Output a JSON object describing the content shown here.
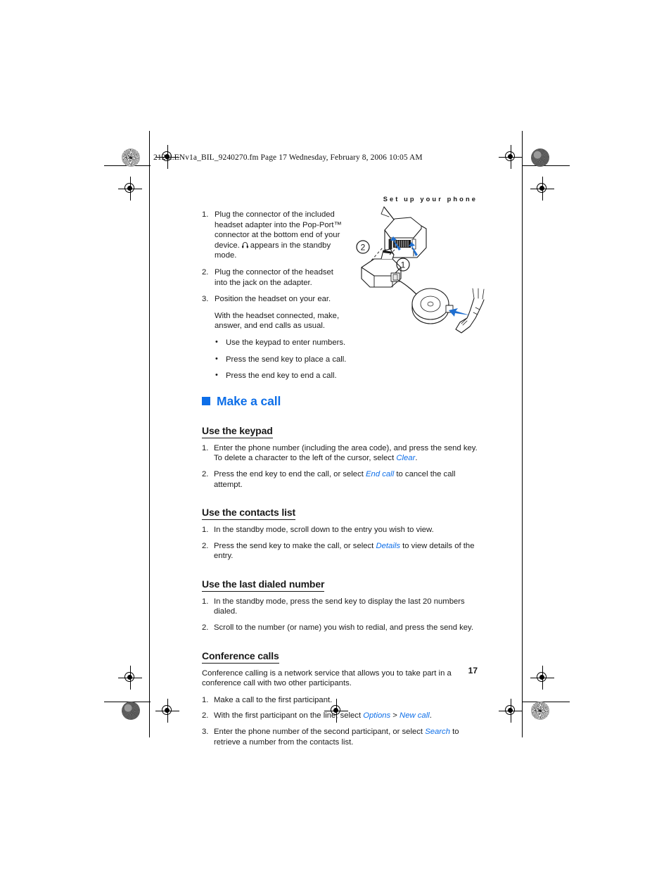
{
  "document": {
    "fm_header": "2128i.ENv1a_BIL_9240270.fm  Page 17  Wednesday, February 8, 2006  10:05 AM",
    "running_head": "Set up your phone",
    "page_number": "17",
    "accent_color": "#0d6ee8",
    "text_color": "#1b1b1b"
  },
  "headset_section": {
    "steps": [
      {
        "num": "1.",
        "text_before": "Plug the connector of the included headset adapter into the Pop-Port™ connector at the bottom end of your device.",
        "icon": "headset-icon",
        "text_after": "appears in the standby mode."
      },
      {
        "num": "2.",
        "text": "Plug the connector of the headset into the jack on the adapter."
      },
      {
        "num": "3.",
        "text": "Position the headset on your ear."
      }
    ],
    "continuation": "With the headset connected, make, answer, and end calls as usual.",
    "bullets": [
      "Use the keypad to enter numbers.",
      "Press the send key to place a call.",
      "Press the end key to end a call."
    ]
  },
  "figure": {
    "name": "headset-adapter-connection-diagram",
    "callouts": [
      "1",
      "2"
    ],
    "arrow_color": "#1f6fd0"
  },
  "chapter": {
    "square_icon": "blue-square-bullet",
    "title": "Make a call"
  },
  "sections": [
    {
      "heading": "Use the keypad",
      "items": [
        {
          "num": "1.",
          "parts": [
            {
              "t": "Enter the phone number (including the area code), and press the send key. To delete a character to the left of the cursor, select ",
              "style": "plain"
            },
            {
              "t": "Clear",
              "style": "ui"
            },
            {
              "t": ".",
              "style": "plain"
            }
          ]
        },
        {
          "num": "2.",
          "parts": [
            {
              "t": "Press the end key to end the call, or select ",
              "style": "plain"
            },
            {
              "t": "End call",
              "style": "ui"
            },
            {
              "t": " to cancel the call attempt.",
              "style": "plain"
            }
          ]
        }
      ]
    },
    {
      "heading": "Use the contacts list",
      "items": [
        {
          "num": "1.",
          "parts": [
            {
              "t": "In the standby mode, scroll down to the entry you wish to view.",
              "style": "plain"
            }
          ]
        },
        {
          "num": "2.",
          "parts": [
            {
              "t": "Press the send key to make the call, or select ",
              "style": "plain"
            },
            {
              "t": "Details",
              "style": "ui"
            },
            {
              "t": " to view details of the entry.",
              "style": "plain"
            }
          ]
        }
      ]
    },
    {
      "heading": "Use the last dialed number",
      "items": [
        {
          "num": "1.",
          "parts": [
            {
              "t": "In the standby mode, press the send key to display the last 20 numbers dialed.",
              "style": "plain"
            }
          ]
        },
        {
          "num": "2.",
          "parts": [
            {
              "t": "Scroll to the number (or name) you wish to redial, and press the send key.",
              "style": "plain"
            }
          ]
        }
      ]
    },
    {
      "heading": "Conference calls",
      "intro": "Conference calling is a network service that allows you to take part in a conference call with two other participants.",
      "items": [
        {
          "num": "1.",
          "parts": [
            {
              "t": "Make a call to the first participant.",
              "style": "plain"
            }
          ]
        },
        {
          "num": "2.",
          "parts": [
            {
              "t": "With the first participant on the line, select ",
              "style": "plain"
            },
            {
              "t": "Options",
              "style": "ui"
            },
            {
              "t": " > ",
              "style": "plain"
            },
            {
              "t": "New call",
              "style": "ui"
            },
            {
              "t": ".",
              "style": "plain"
            }
          ]
        },
        {
          "num": "3.",
          "parts": [
            {
              "t": "Enter the phone number of the second participant, or select ",
              "style": "plain"
            },
            {
              "t": "Search",
              "style": "ui"
            },
            {
              "t": " to retrieve a number from the contacts list.",
              "style": "plain"
            }
          ]
        }
      ]
    }
  ]
}
